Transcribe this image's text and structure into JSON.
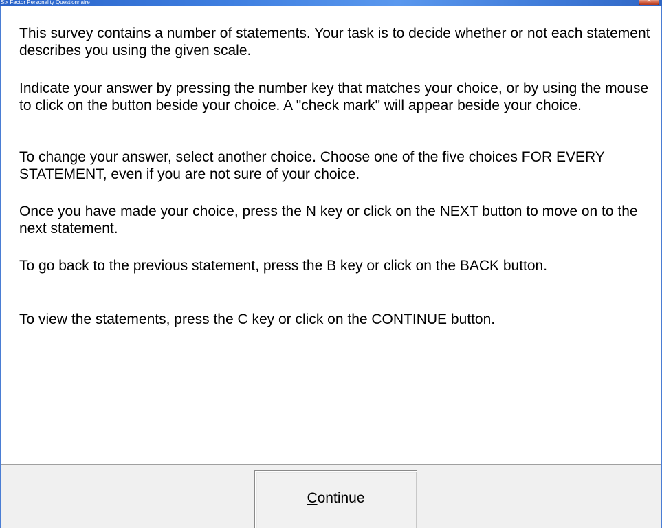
{
  "window": {
    "title": "Six Factor Personality Questionnaire",
    "close_glyph": "x"
  },
  "instructions": {
    "p1": "This survey contains a number of statements. Your task is to decide whether or not each statement describes you using the given scale.",
    "p2": "Indicate your answer by pressing the number key that matches your choice, or by using the mouse to click on the button beside your choice. A \"check mark\" will appear beside your choice.",
    "p3": "To change your answer, select another choice.  Choose one of the five choices FOR EVERY STATEMENT, even if you are not sure of your choice.",
    "p4": "Once you have made your choice, press the N key or click on the NEXT button to move on to the next statement.",
    "p5": "To go back to the previous statement, press the B key or click on the BACK button.",
    "p6": "To view the statements, press the C key or click on the CONTINUE button."
  },
  "footer": {
    "continue_mnemonic": "C",
    "continue_rest": "ontinue"
  }
}
